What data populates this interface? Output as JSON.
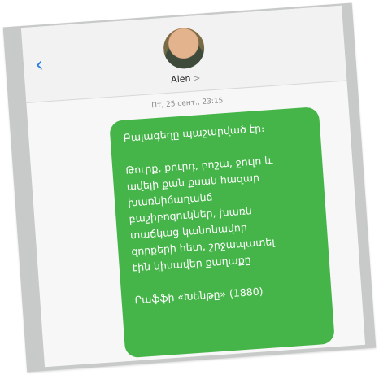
{
  "header": {
    "back_icon": "chevron-left-icon",
    "contact_name": "Alen",
    "contact_chevron": ">"
  },
  "conversation": {
    "timestamp": "Пт, 25 сент., 23:15",
    "message": {
      "paragraph_1": "Բալագեղը պաշարված էր։",
      "paragraph_2": "Թուրք, քուրդ, բոշա, ջուլո և\nավելի քան քսան հազար\nխառնիճաղանճ\nբաշիբոզուկներ, խառն\nտաճկաց կանոնավոր\nզորքերի հետ, շրջապատել\nէին կիսավեր քաղաքը",
      "paragraph_3": "Րաֆֆի «Խենթը» (1880)"
    }
  },
  "colors": {
    "bubble": "#45b549",
    "accent": "#2a7be0",
    "background": "#c7cac8"
  }
}
